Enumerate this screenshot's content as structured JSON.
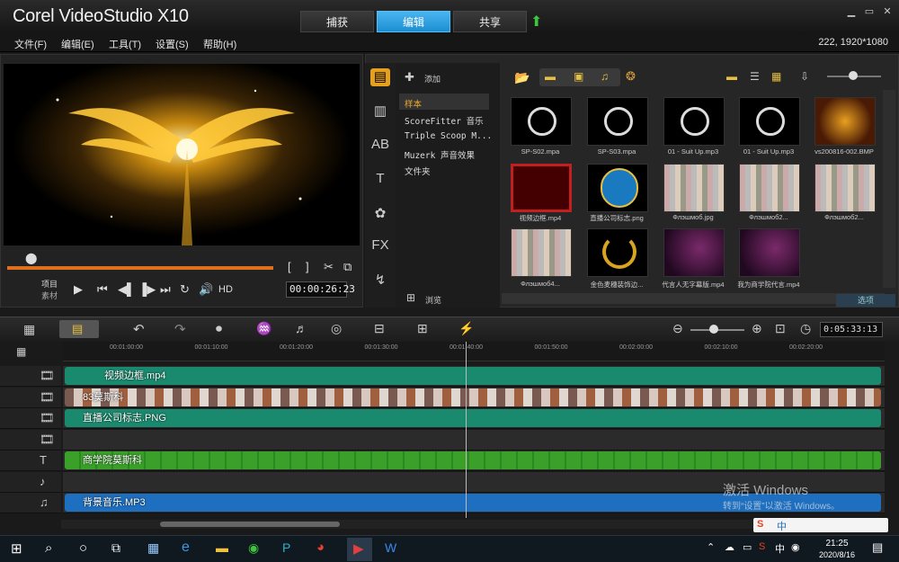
{
  "app": {
    "logo": "Corel VideoStudio X10"
  },
  "top_tabs": [
    {
      "label": "捕获"
    },
    {
      "label": "编辑"
    },
    {
      "label": "共享"
    }
  ],
  "window_controls": {
    "minimize": "▁",
    "maximize": "▭",
    "close": "✕"
  },
  "menu": [
    {
      "label": "文件(F)"
    },
    {
      "label": "编辑(E)"
    },
    {
      "label": "工具(T)"
    },
    {
      "label": "设置(S)"
    },
    {
      "label": "帮助(H)"
    }
  ],
  "resolution_info": "222, 1920*1080",
  "player": {
    "mode_project": "项目",
    "mode_clip": "素材",
    "hd": "HD",
    "timecode": "00:00:26:23"
  },
  "library": {
    "add_label": "添加",
    "browse_label": "浏览",
    "options_label": "选项",
    "folders": [
      {
        "label": "样本"
      },
      {
        "label": "ScoreFitter 音乐"
      },
      {
        "label": "Triple Scoop M..."
      },
      {
        "label": "Muzerk 声音效果"
      },
      {
        "label": "文件夹"
      }
    ],
    "thumbnails": [
      {
        "label": "SP-S02.mpa",
        "kind": "audio"
      },
      {
        "label": "SP-S03.mpa",
        "kind": "audio"
      },
      {
        "label": "01 - Suit Up.mp3",
        "kind": "audio"
      },
      {
        "label": "01 - Suit Up.mp3",
        "kind": "audio"
      },
      {
        "label": "vs200816-002.BMP",
        "kind": "image"
      },
      {
        "label": "视频边框.mp4",
        "kind": "frame"
      },
      {
        "label": "直播公司标志.png",
        "kind": "logo"
      },
      {
        "label": "Флэшмоб.jpg",
        "kind": "collage"
      },
      {
        "label": "Флэшмоб2...",
        "kind": "collage"
      },
      {
        "label": "Флэшмоб2...",
        "kind": "collage"
      },
      {
        "label": "Флэшмоб4...",
        "kind": "collage"
      },
      {
        "label": "金色麦穗装饰边...",
        "kind": "wreath"
      },
      {
        "label": "代言人无字幕版.mp4",
        "kind": "purple"
      },
      {
        "label": "我为商学院代言.mp4",
        "kind": "purple"
      }
    ]
  },
  "timeline": {
    "total_duration": "0:05:33:13",
    "ruler_ticks": [
      "00:01:00:00",
      "00:01:10:00",
      "00:01:20:00",
      "00:01:30:00",
      "00:01:40:00",
      "00:01:50:00",
      "00:02:00:00",
      "00:02:10:00",
      "00:02:20:00"
    ],
    "tracks": [
      {
        "clip": "视频边框.mp4",
        "color": "#1a8a6e"
      },
      {
        "clip": "83莫斯科",
        "color": "#1a8a6e"
      },
      {
        "clip": "直播公司标志.PNG",
        "color": "#1a8a6e"
      },
      {
        "clip": "",
        "color": ""
      },
      {
        "clip": "商学院莫斯科",
        "color": "#3aa02a"
      },
      {
        "clip": "",
        "color": ""
      },
      {
        "clip": "背景音乐.MP3",
        "color": "#1e6fbf"
      }
    ]
  },
  "watermark": {
    "line1": "激活 Windows",
    "line2": "转到“设置”以激活 Windows。"
  },
  "taskbar": {
    "time": "21:25",
    "date": "2020/8/16",
    "ime": "中"
  }
}
